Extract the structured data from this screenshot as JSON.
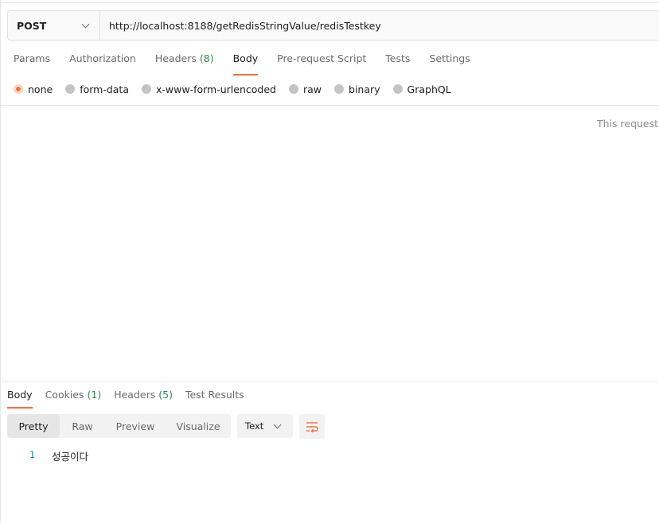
{
  "request": {
    "method": "POST",
    "url": "http://localhost:8188/getRedisStringValue/redisTestkey"
  },
  "request_tabs": [
    {
      "label": "Params"
    },
    {
      "label": "Authorization"
    },
    {
      "label": "Headers",
      "count": "(8)"
    },
    {
      "label": "Body",
      "active": true
    },
    {
      "label": "Pre-request Script"
    },
    {
      "label": "Tests"
    },
    {
      "label": "Settings"
    }
  ],
  "body_types": [
    "none",
    "form-data",
    "x-www-form-urlencoded",
    "raw",
    "binary",
    "GraphQL"
  ],
  "selected_body_type": "none",
  "no_body_message": "This request d",
  "response_tabs": [
    {
      "label": "Body",
      "active": true
    },
    {
      "label": "Cookies",
      "count": "(1)"
    },
    {
      "label": "Headers",
      "count": "(5)"
    },
    {
      "label": "Test Results"
    }
  ],
  "view_modes": [
    "Pretty",
    "Raw",
    "Preview",
    "Visualize"
  ],
  "active_view_mode": "Pretty",
  "format": "Text",
  "response_line": {
    "number": "1",
    "text": "성공이다"
  },
  "colors": {
    "accent": "#ff6c37",
    "count_green": "#2c8a52"
  },
  "icons": {
    "method_dropdown": "chevron-down-icon",
    "format_dropdown": "chevron-down-icon",
    "wrap": "wrap-lines-icon"
  }
}
